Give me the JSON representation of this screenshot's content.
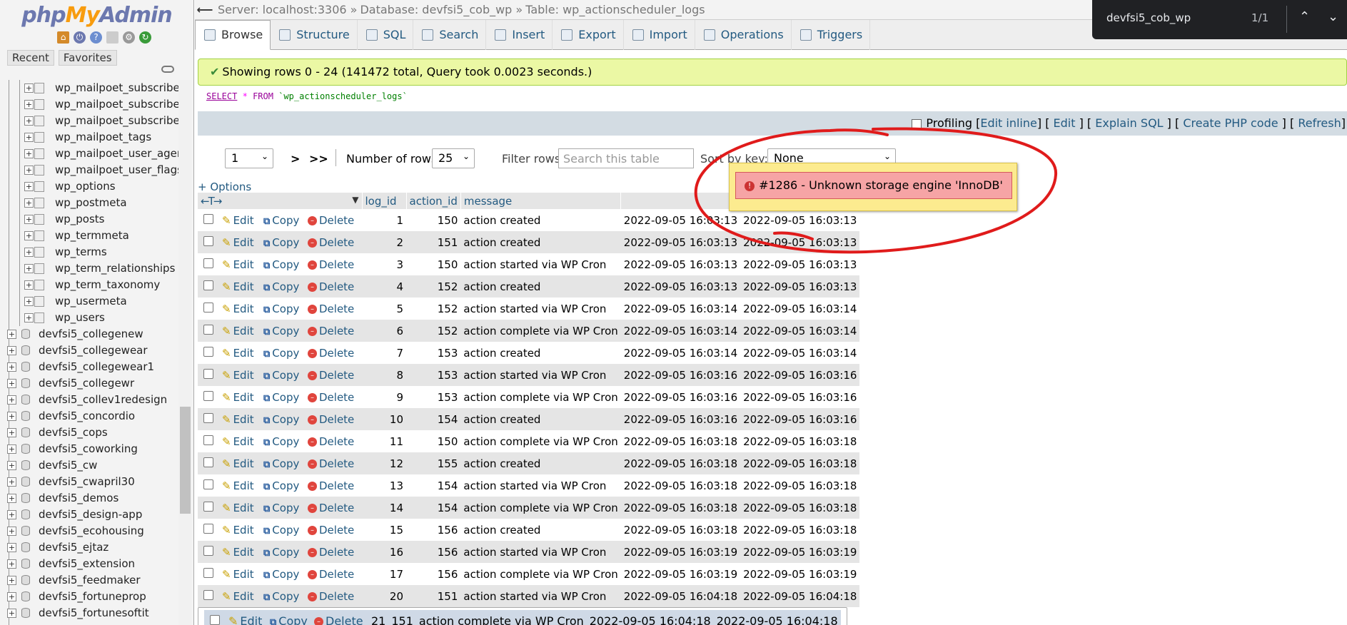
{
  "logo": {
    "php": "php",
    "my": "My",
    "admin": "Admin"
  },
  "sidebar": {
    "tabs": [
      "Recent",
      "Favorites"
    ],
    "tables": [
      "wp_mailpoet_subscriber_i",
      "wp_mailpoet_subscriber_s",
      "wp_mailpoet_subscriber_t",
      "wp_mailpoet_tags",
      "wp_mailpoet_user_agents",
      "wp_mailpoet_user_flags",
      "wp_options",
      "wp_postmeta",
      "wp_posts",
      "wp_termmeta",
      "wp_terms",
      "wp_term_relationships",
      "wp_term_taxonomy",
      "wp_usermeta",
      "wp_users"
    ],
    "databases": [
      "devfsi5_collegenew",
      "devfsi5_collegewear",
      "devfsi5_collegewear1",
      "devfsi5_collegewr",
      "devfsi5_collev1redesign",
      "devfsi5_concordio",
      "devfsi5_cops",
      "devfsi5_coworking",
      "devfsi5_cw",
      "devfsi5_cwapril30",
      "devfsi5_demos",
      "devfsi5_design-app",
      "devfsi5_ecohousing",
      "devfsi5_ejtaz",
      "devfsi5_extension",
      "devfsi5_feedmaker",
      "devfsi5_fortuneprop",
      "devfsi5_fortunesoftit"
    ]
  },
  "breadcrumb": {
    "server": "Server: localhost:3306 »",
    "database": "Database: devfsi5_cob_wp »",
    "table": "Table: wp_actionscheduler_logs"
  },
  "tabs": [
    "Browse",
    "Structure",
    "SQL",
    "Search",
    "Insert",
    "Export",
    "Import",
    "Operations",
    "Triggers"
  ],
  "find": {
    "query": "devfsi5_cob_wp",
    "count": "1/1",
    "up": "^",
    "down": "v",
    "close": "✕"
  },
  "message": "Showing rows 0 - 24 (141472 total, Query took 0.0023 seconds.)",
  "sql": {
    "select": "SELECT",
    "star": "*",
    "from": "FROM",
    "table": "`wp_actionscheduler_logs`"
  },
  "sqlbar": {
    "profiling": "Profiling",
    "edit_inline": "Edit inline",
    "edit": "Edit",
    "explain": "Explain SQL",
    "create_php": "Create PHP code",
    "refresh": "Refresh"
  },
  "nav": {
    "page": "1",
    "next": ">",
    "last": ">>",
    "rows_label": "Number of rows:",
    "rows": "25",
    "filter_label": "Filter rows:",
    "filter_placeholder": "Search this table",
    "sort_label": "Sort by key:",
    "sort_value": "None"
  },
  "options_link": "+ Options",
  "columns": {
    "arrows": "←T→",
    "log_id": "log_id",
    "action_id": "action_id",
    "message": "message"
  },
  "row_actions": {
    "edit": "Edit",
    "copy": "Copy",
    "delete": "Delete"
  },
  "rows": [
    {
      "log_id": "1",
      "action_id": "150",
      "message": "action created",
      "d1": "2022-09-05 16:03:13",
      "d2": "2022-09-05 16:03:13"
    },
    {
      "log_id": "2",
      "action_id": "151",
      "message": "action created",
      "d1": "2022-09-05 16:03:13",
      "d2": "2022-09-05 16:03:13"
    },
    {
      "log_id": "3",
      "action_id": "150",
      "message": "action started via WP Cron",
      "d1": "2022-09-05 16:03:13",
      "d2": "2022-09-05 16:03:13"
    },
    {
      "log_id": "4",
      "action_id": "152",
      "message": "action created",
      "d1": "2022-09-05 16:03:13",
      "d2": "2022-09-05 16:03:13"
    },
    {
      "log_id": "5",
      "action_id": "152",
      "message": "action started via WP Cron",
      "d1": "2022-09-05 16:03:14",
      "d2": "2022-09-05 16:03:14"
    },
    {
      "log_id": "6",
      "action_id": "152",
      "message": "action complete via WP Cron",
      "d1": "2022-09-05 16:03:14",
      "d2": "2022-09-05 16:03:14"
    },
    {
      "log_id": "7",
      "action_id": "153",
      "message": "action created",
      "d1": "2022-09-05 16:03:14",
      "d2": "2022-09-05 16:03:14"
    },
    {
      "log_id": "8",
      "action_id": "153",
      "message": "action started via WP Cron",
      "d1": "2022-09-05 16:03:16",
      "d2": "2022-09-05 16:03:16"
    },
    {
      "log_id": "9",
      "action_id": "153",
      "message": "action complete via WP Cron",
      "d1": "2022-09-05 16:03:16",
      "d2": "2022-09-05 16:03:16"
    },
    {
      "log_id": "10",
      "action_id": "154",
      "message": "action created",
      "d1": "2022-09-05 16:03:16",
      "d2": "2022-09-05 16:03:16"
    },
    {
      "log_id": "11",
      "action_id": "150",
      "message": "action complete via WP Cron",
      "d1": "2022-09-05 16:03:18",
      "d2": "2022-09-05 16:03:18"
    },
    {
      "log_id": "12",
      "action_id": "155",
      "message": "action created",
      "d1": "2022-09-05 16:03:18",
      "d2": "2022-09-05 16:03:18"
    },
    {
      "log_id": "13",
      "action_id": "154",
      "message": "action started via WP Cron",
      "d1": "2022-09-05 16:03:18",
      "d2": "2022-09-05 16:03:18"
    },
    {
      "log_id": "14",
      "action_id": "154",
      "message": "action complete via WP Cron",
      "d1": "2022-09-05 16:03:18",
      "d2": "2022-09-05 16:03:18"
    },
    {
      "log_id": "15",
      "action_id": "156",
      "message": "action created",
      "d1": "2022-09-05 16:03:18",
      "d2": "2022-09-05 16:03:18"
    },
    {
      "log_id": "16",
      "action_id": "156",
      "message": "action started via WP Cron",
      "d1": "2022-09-05 16:03:19",
      "d2": "2022-09-05 16:03:19"
    },
    {
      "log_id": "17",
      "action_id": "156",
      "message": "action complete via WP Cron",
      "d1": "2022-09-05 16:03:19",
      "d2": "2022-09-05 16:03:19"
    },
    {
      "log_id": "20",
      "action_id": "151",
      "message": "action started via WP Cron",
      "d1": "2022-09-05 16:04:18",
      "d2": "2022-09-05 16:04:18"
    },
    {
      "log_id": "21",
      "action_id": "151",
      "message": "action complete via WP Cron",
      "d1": "2022-09-05 16:04:18",
      "d2": "2022-09-05 16:04:18"
    }
  ],
  "error": "#1286 - Unknown storage engine 'InnoDB'",
  "colors": {
    "link": "#235a81",
    "success_bg": "#ebf8a4",
    "error_bg": "#f6a4a5",
    "annotation": "#e01b1b"
  }
}
